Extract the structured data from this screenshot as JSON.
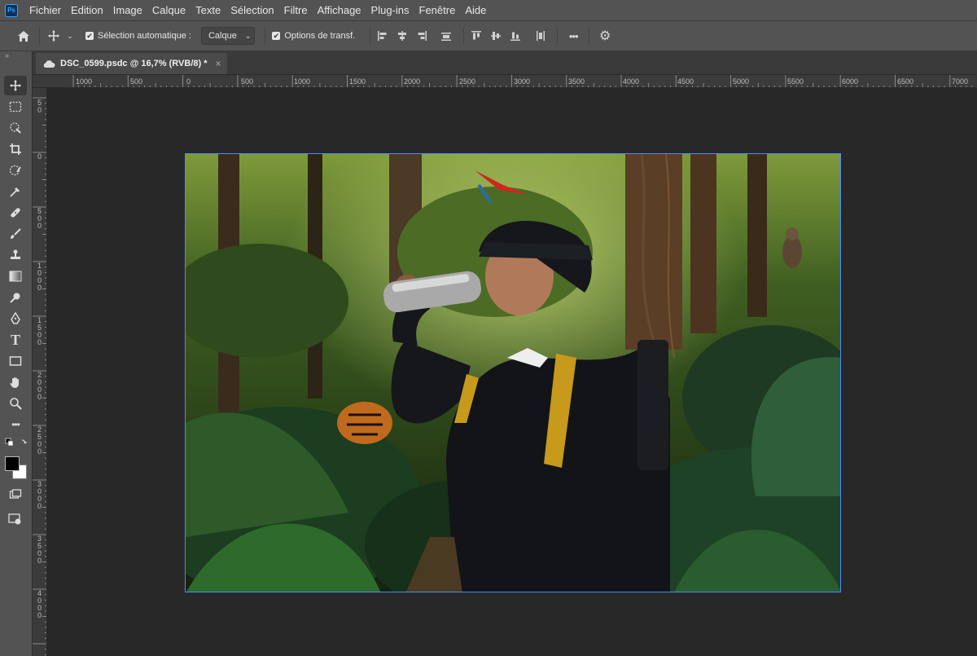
{
  "app": {
    "logo_text": "Ps"
  },
  "menu": [
    "Fichier",
    "Edition",
    "Image",
    "Calque",
    "Texte",
    "Sélection",
    "Filtre",
    "Affichage",
    "Plug-ins",
    "Fenêtre",
    "Aide"
  ],
  "options_bar": {
    "auto_select_label": "Sélection automatique :",
    "auto_select_value": "Calque",
    "transform_label": "Options de transf.",
    "more_icon": "•••"
  },
  "document": {
    "tab_title": "DSC_0599.psdc @ 16,7% (RVB/8) *",
    "close_glyph": "×"
  },
  "ruler": {
    "horizontal": [
      "1000",
      "500",
      "0",
      "500",
      "1000",
      "1500",
      "2000",
      "2500",
      "3000",
      "3500",
      "4000",
      "4500",
      "5000",
      "5500",
      "6000",
      "6500",
      "7000"
    ],
    "vertical": [
      "5 0",
      "0",
      "5 0 0",
      "1 0 0 0",
      "1 5 0 0",
      "2 0 0 0",
      "2 5 0 0",
      "3 0 0 0",
      "3 5 0 0",
      "4 0 0 0"
    ]
  },
  "colors": {
    "accent": "#31a8ff",
    "selection_border": "#4a8cff",
    "foreground": "#000000",
    "background": "#ffffff"
  },
  "tools": [
    "move-icon",
    "marquee-icon",
    "quick-select-icon",
    "crop-icon",
    "frame-icon",
    "eyedropper-icon",
    "healing-icon",
    "brush-icon",
    "stamp-icon",
    "gradient-icon",
    "dodge-icon",
    "pen-icon",
    "type-icon",
    "shape-icon",
    "hand-icon",
    "zoom-icon",
    "more-icon"
  ]
}
